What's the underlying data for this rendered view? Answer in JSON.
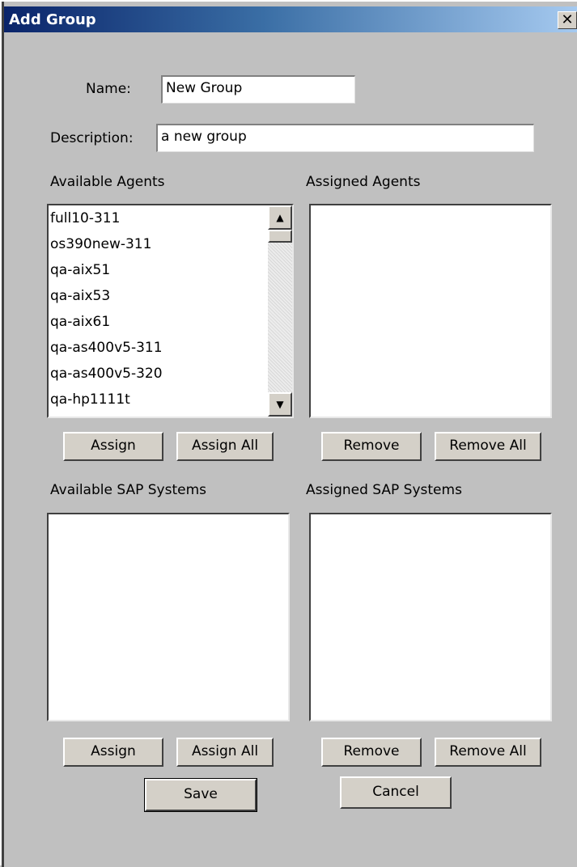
{
  "window": {
    "title": "Add Group",
    "close_glyph": "✕"
  },
  "form": {
    "name_label": "Name:",
    "name_value": "New Group",
    "description_label": "Description:",
    "description_value": "a new group"
  },
  "agents": {
    "available_label": "Available Agents",
    "assigned_label": "Assigned Agents",
    "available_items": [
      "full10-311",
      "os390new-311",
      "qa-aix51",
      "qa-aix53",
      "qa-aix61",
      "qa-as400v5-311",
      "qa-as400v5-320",
      "qa-hp1111t"
    ],
    "assigned_items": [],
    "assign_label": "Assign",
    "assign_all_label": "Assign All",
    "remove_label": "Remove",
    "remove_all_label": "Remove All"
  },
  "sap": {
    "available_label": "Available SAP Systems",
    "assigned_label": "Assigned SAP Systems",
    "available_items": [],
    "assigned_items": [],
    "assign_label": "Assign",
    "assign_all_label": "Assign All",
    "remove_label": "Remove",
    "remove_all_label": "Remove All"
  },
  "footer": {
    "save_label": "Save",
    "cancel_label": "Cancel"
  },
  "icons": {
    "scroll_up": "scroll-up-arrow-icon",
    "scroll_down": "scroll-down-arrow-icon",
    "close": "close-icon"
  }
}
